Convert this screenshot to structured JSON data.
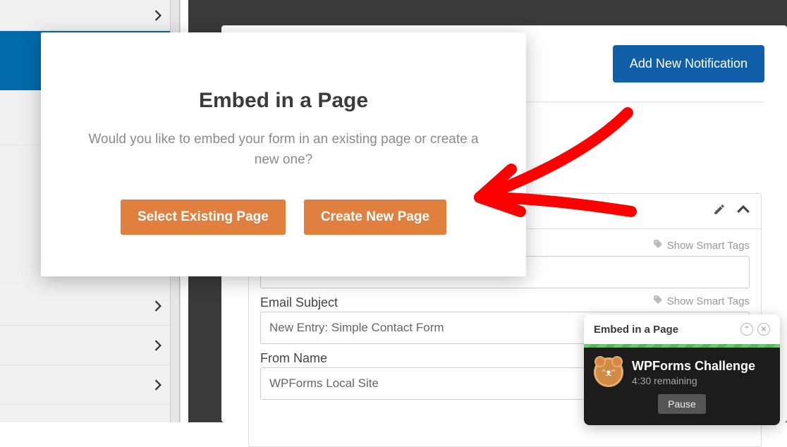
{
  "sidebar": {
    "items": [
      {
        "type": "top"
      },
      {
        "type": "active"
      },
      {
        "type": "blank"
      },
      {
        "type": "expand"
      },
      {
        "type": "expand"
      },
      {
        "type": "expand"
      }
    ]
  },
  "header": {
    "add_notification": "Add New Notification"
  },
  "notification_card": {
    "smart_tags_label": "Show Smart Tags",
    "fields": {
      "email_subject": {
        "label": "Email Subject",
        "value": "New Entry: Simple Contact Form"
      },
      "from_name": {
        "label": "From Name",
        "value": "WPForms Local Site"
      }
    }
  },
  "modal": {
    "title": "Embed in a Page",
    "message": "Would you like to embed your form in an existing page or create a new one?",
    "select_existing": "Select Existing Page",
    "create_new": "Create New Page"
  },
  "challenge": {
    "header": "Embed in a Page",
    "title": "WPForms Challenge",
    "remaining": "4:30 remaining",
    "pause": "Pause"
  },
  "colors": {
    "primary_button": "#e17f3e",
    "blue_button": "#115fa8",
    "annotation": "#ff0000"
  }
}
